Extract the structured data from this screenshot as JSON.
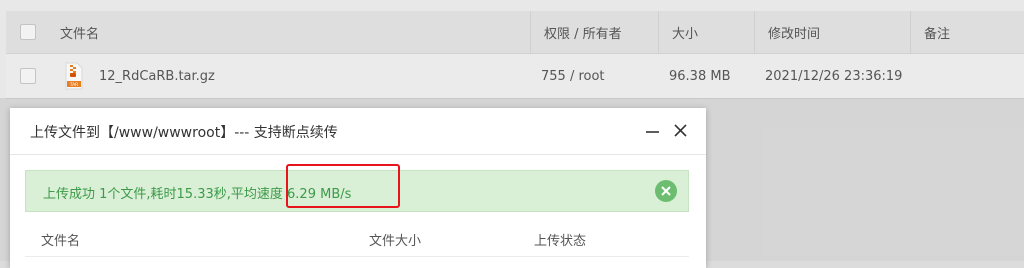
{
  "table": {
    "headers": {
      "name": "文件名",
      "perm": "权限 / 所有者",
      "size": "大小",
      "mtime": "修改时间",
      "note": "备注"
    },
    "rows": [
      {
        "name": "12_RdCaRB.tar.gz",
        "perm": "755 / root",
        "size": "96.38 MB",
        "mtime": "2021/12/26 23:36:19",
        "icon": "gz-archive-icon"
      }
    ]
  },
  "dialog": {
    "title": "上传文件到【/www/wwwroot】--- 支持断点续传",
    "minimize_icon": "minimize-icon",
    "close_icon": "close-icon",
    "alert": {
      "prefix": "上传成功 1个文件,耗时15.33秒,平均速度 ",
      "speed": "6.29 MB/s",
      "color": "#3c9a48",
      "background": "#d9efd6"
    },
    "list_headers": {
      "name": "文件名",
      "size": "文件大小",
      "status": "上传状态"
    }
  },
  "annotation": {
    "color": "#e8141c"
  }
}
